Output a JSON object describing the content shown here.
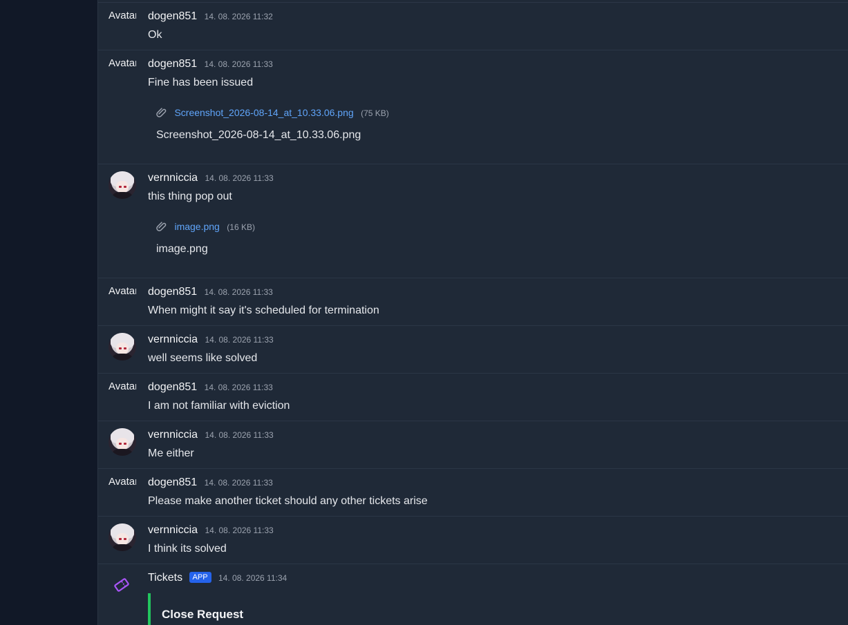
{
  "messages": [
    {
      "author": "dogen851",
      "avatar_alt": "Avatar",
      "timestamp": "14. 08. 2026 11:32",
      "text": "Ok"
    },
    {
      "author": "dogen851",
      "avatar_alt": "Avatar",
      "timestamp": "14. 08. 2026 11:33",
      "text": "Fine has been issued",
      "attachment": {
        "name": "Screenshot_2026-08-14_at_10.33.06.png",
        "size": "(75 KB)",
        "caption": "Screenshot_2026-08-14_at_10.33.06.png"
      }
    },
    {
      "author": "vernniccia",
      "timestamp": "14. 08. 2026 11:33",
      "text": "this thing pop out",
      "attachment": {
        "name": "image.png",
        "size": "(16 KB)",
        "caption": "image.png"
      }
    },
    {
      "author": "dogen851",
      "avatar_alt": "Avatar",
      "timestamp": "14. 08. 2026 11:33",
      "text": "When might it say it's scheduled for termination"
    },
    {
      "author": "vernniccia",
      "timestamp": "14. 08. 2026 11:33",
      "text": "well seems like solved"
    },
    {
      "author": "dogen851",
      "avatar_alt": "Avatar",
      "timestamp": "14. 08. 2026 11:33",
      "text": "I am not familiar with eviction"
    },
    {
      "author": "vernniccia",
      "timestamp": "14. 08. 2026 11:33",
      "text": "Me either"
    },
    {
      "author": "dogen851",
      "avatar_alt": "Avatar",
      "timestamp": "14. 08. 2026 11:33",
      "text": "Please make another ticket should any other tickets arise"
    },
    {
      "author": "vernniccia",
      "timestamp": "14. 08. 2026 11:33",
      "text": "I think its solved"
    },
    {
      "author": "Tickets",
      "badge": "APP",
      "timestamp": "14. 08. 2026 11:34",
      "embed_title": "Close Request"
    }
  ],
  "colors": {
    "accent_link": "#60a5fa",
    "app_badge": "#2563eb",
    "embed_border": "#22c55e",
    "ticket_icon": "#a855f7"
  },
  "icons": {
    "attachment": "paperclip-icon",
    "app": "ticket-icon"
  }
}
